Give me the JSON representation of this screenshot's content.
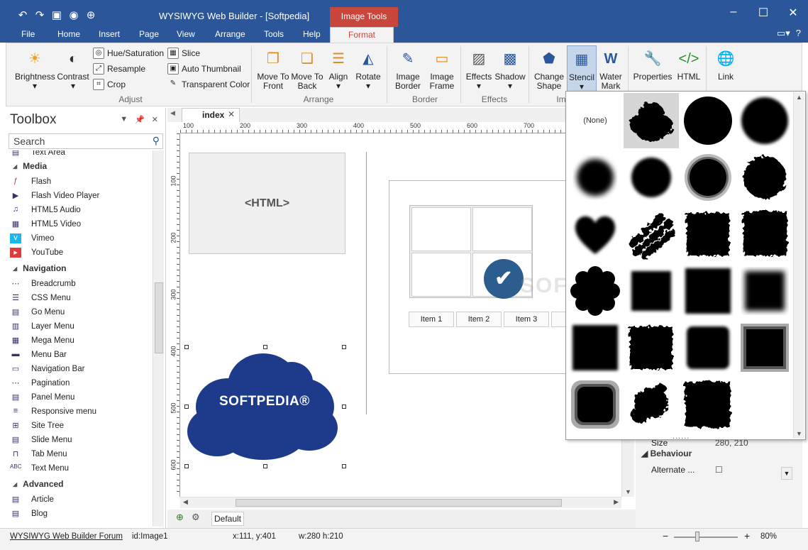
{
  "app": {
    "title": "WYSIWYG Web Builder - [Softpedia]",
    "context_tab": "Image Tools",
    "help_glyph": "?"
  },
  "qat": [
    "undo-icon",
    "redo-icon",
    "save-icon",
    "preview-icon",
    "publish-icon"
  ],
  "menu_tabs": [
    "File",
    "Home",
    "Insert",
    "Page",
    "View",
    "Arrange",
    "Tools",
    "Help",
    "Format"
  ],
  "ribbon": {
    "adjust": {
      "brightness": "Brightness",
      "contrast": "Contrast",
      "hue": "Hue/Saturation",
      "resample": "Resample",
      "crop": "Crop",
      "slice": "Slice",
      "auto_thumb": "Auto Thumbnail",
      "transparent": "Transparent Color",
      "group": "Adjust"
    },
    "arrange": {
      "front": "Move To Front",
      "back": "Move To Back",
      "align": "Align",
      "rotate": "Rotate",
      "group": "Arrange"
    },
    "border": {
      "image_border": "Image Border",
      "image_frame": "Image Frame",
      "group": "Border"
    },
    "effects": {
      "effects": "Effects",
      "shadow": "Shadow",
      "group": "Effects"
    },
    "shape": {
      "change_shape": "Change Shape",
      "stencil": "Stencil",
      "watermark": "Water Mark",
      "group": "Im"
    },
    "misc": {
      "properties": "Properties",
      "html": "HTML",
      "link": "Link"
    }
  },
  "toolbox": {
    "title": "Toolbox",
    "search_placeholder": "Search",
    "top_item": "Text Area",
    "sections": [
      {
        "name": "Media",
        "items": [
          "Flash",
          "Flash Video Player",
          "HTML5 Audio",
          "HTML5 Video",
          "Vimeo",
          "YouTube"
        ]
      },
      {
        "name": "Navigation",
        "items": [
          "Breadcrumb",
          "CSS Menu",
          "Go Menu",
          "Layer Menu",
          "Mega Menu",
          "Menu Bar",
          "Navigation Bar",
          "Pagination",
          "Panel Menu",
          "Responsive menu",
          "Site Tree",
          "Slide Menu",
          "Tab Menu",
          "Text Menu"
        ]
      },
      {
        "name": "Advanced",
        "items": [
          "Article",
          "Blog"
        ]
      }
    ]
  },
  "document": {
    "tab": "index",
    "ruler_h": [
      "100",
      "200",
      "300",
      "400",
      "500",
      "600",
      "700"
    ],
    "ruler_v": [
      "100",
      "200",
      "300",
      "400",
      "500",
      "600"
    ],
    "html_placeholder": "<HTML>",
    "nav_items": [
      "Item 1",
      "Item 2",
      "Item 3"
    ],
    "cloud_text": "SOFTPEDIA®",
    "watermark": "SOFTPEDIA",
    "page_name": "Default"
  },
  "stencil": {
    "none_label": "(None)",
    "grip": "......"
  },
  "properties": {
    "size_key": "Size",
    "size_val": "280, 210",
    "section": "Behaviour",
    "alt_key": "Alternate ..."
  },
  "status": {
    "forum": "WYSIWYG Web Builder Forum",
    "id": "id:Image1",
    "pos": "x:111, y:401",
    "size": "w:280 h:210",
    "zoom_minus": "−",
    "zoom_plus": "+",
    "zoom": "80%"
  },
  "colors": {
    "brand": "#2b579a",
    "context": "#c9463d",
    "ribbon": "#f3f3f3"
  }
}
